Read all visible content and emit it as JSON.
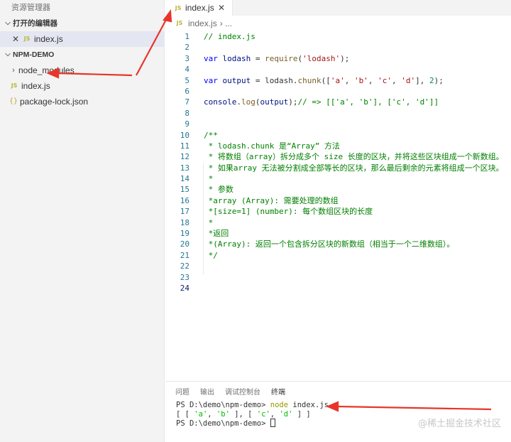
{
  "sidebar": {
    "title": "资源管理器",
    "open_editors_header": "打开的编辑器",
    "open_editors": [
      {
        "close": "✕",
        "badge": "JS",
        "label": "index.js"
      }
    ],
    "project_header": "NPM-DEMO",
    "items": [
      {
        "label": "node_modules",
        "icon": "chevron-right-icon"
      },
      {
        "label": "index.js",
        "badge": "JS"
      },
      {
        "label": "package-lock.json",
        "badge": "{}"
      }
    ]
  },
  "editor": {
    "tab": {
      "badge": "JS",
      "label": "index.js",
      "close": "✕"
    },
    "breadcrumb": {
      "badge": "JS",
      "file": "index.js",
      "rest": "› ..."
    },
    "line_numbers": [
      "1",
      "2",
      "3",
      "4",
      "5",
      "6",
      "7",
      "8",
      "9",
      "10",
      "11",
      "12",
      "13",
      "14",
      "15",
      "16",
      "17",
      "18",
      "19",
      "20",
      "21",
      "22",
      "23",
      "24"
    ],
    "code": {
      "l1": "// index.js",
      "l3_kw": "var",
      "l3_var": "lodash",
      "l3_eq": " = ",
      "l3_fn": "require",
      "l3_str": "'lodash'",
      "l3_end": ");",
      "l5_kw": "var",
      "l5_var": "output",
      "l5_mid": " = lodash.",
      "l5_fn": "chunk",
      "l5_a": "'a'",
      "l5_b": "'b'",
      "l5_c": "'c'",
      "l5_d": "'d'",
      "l5_num": "2",
      "l7_obj": "console",
      "l7_fn": "log",
      "l7_arg": "output",
      "l7_comment": "// => [['a', 'b'], ['c', 'd']]",
      "l10": "/**",
      "l11": " * lodash.chunk 是“Array” 方法",
      "l12": " * 将数组（array）拆分成多个 size 长度的区块，并将这些区块组成一个新数组。",
      "l13": " * 如果array 无法被分割成全部等长的区块，那么最后剩余的元素将组成一个区块。",
      "l14": " *",
      "l15": " * 参数",
      "l16": " *array (Array): 需要处理的数组",
      "l17": " *[size=1] (number): 每个数组区块的长度",
      "l18": " *",
      "l19": " *返回",
      "l20": " *(Array): 返回一个包含拆分区块的新数组（相当于一个二维数组）。",
      "l21": " */"
    }
  },
  "panel": {
    "tabs": [
      "问题",
      "输出",
      "调试控制台",
      "终端"
    ],
    "terminal": {
      "l1_prompt": "PS D:\\demo\\npm-demo> ",
      "l1_cmd": "node",
      "l1_arg": " index.js",
      "l2_a": "[ [ ",
      "l2_s1": "'a'",
      "l2_sep1": ", ",
      "l2_s2": "'b'",
      "l2_mid": " ], [ ",
      "l2_s3": "'c'",
      "l2_sep2": ", ",
      "l2_s4": "'d'",
      "l2_end": " ] ]",
      "l3_prompt": "PS D:\\demo\\npm-demo> "
    }
  },
  "watermark": "@稀土掘金技术社区",
  "colors": {
    "annotation_arrow": "#e8352a",
    "comment": "#008000",
    "keyword": "#0000ff",
    "string": "#a31515"
  }
}
